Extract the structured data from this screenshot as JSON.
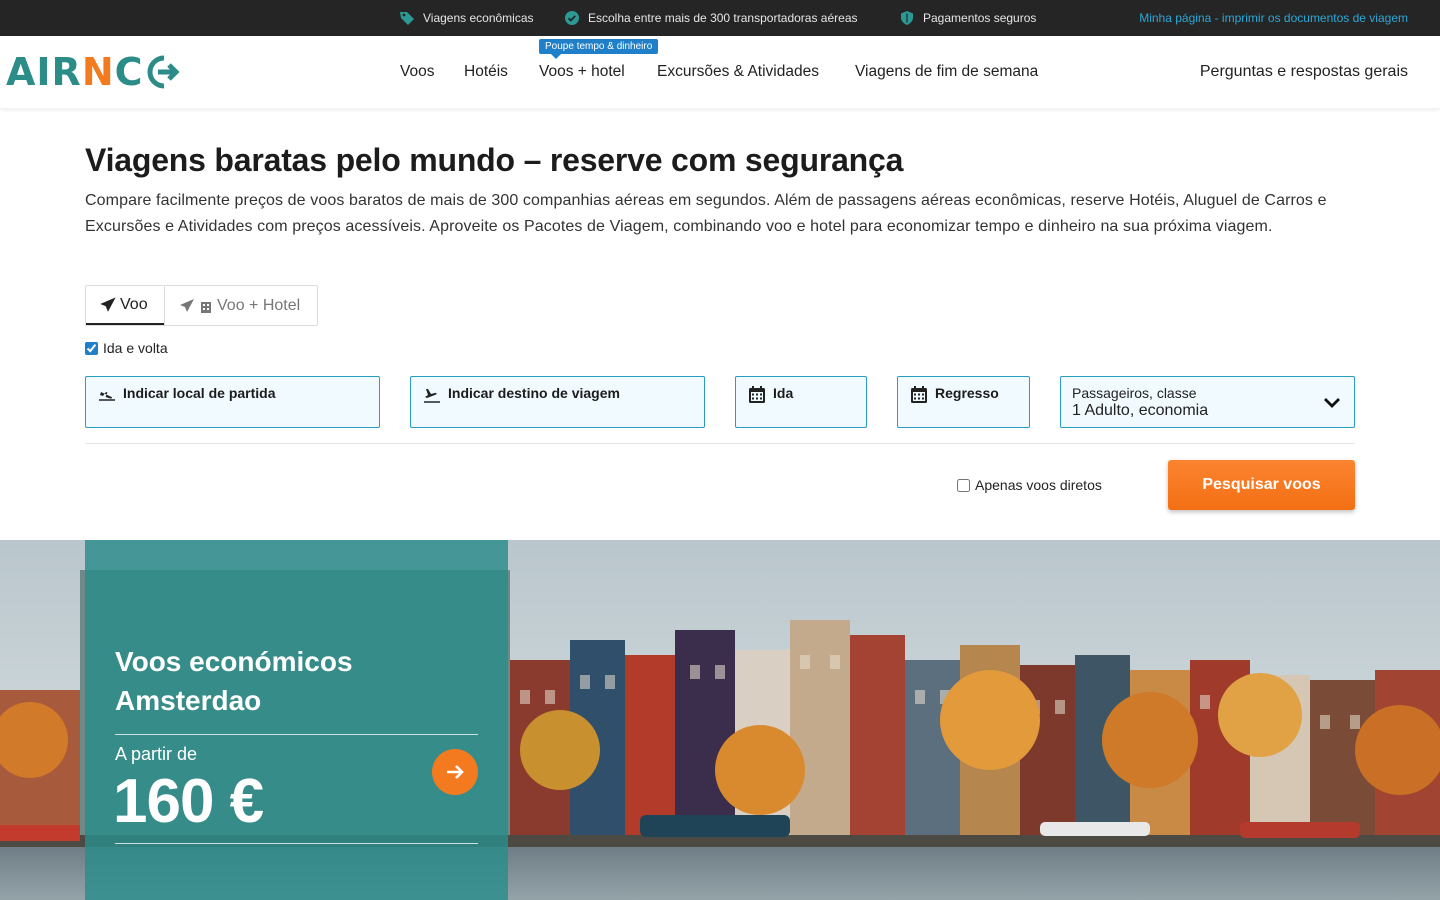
{
  "topbar": {
    "usp1": "Viagens econômicas",
    "usp2": "Escolha entre mais de 300 transportadoras aéreas",
    "usp3": "Pagamentos seguros",
    "my_page": "Minha página - imprimir os documentos de viagem"
  },
  "header": {
    "logo_prefix": "AIR",
    "logo_orange": "N",
    "logo_suffix": "C",
    "nav": {
      "flights": "Voos",
      "hotels": "Hotéis",
      "flight_hotel": "Voos + hotel",
      "flight_hotel_badge": "Poupe tempo & dinheiro",
      "excursions": "Excursões & Atividades",
      "weekend": "Viagens de fim de semana"
    },
    "faq": "Perguntas e respostas gerais"
  },
  "hero": {
    "title": "Viagens baratas pelo mundo – reserve com segurança",
    "intro": "Compare facilmente preços de voos baratos de mais de 300 companhias aéreas em segundos. Além de passagens aéreas econômicas, reserve Hotéis, Aluguel de Carros e Excursões e Atividades com preços acessíveis. Aproveite os Pacotes de Viagem, combinando voo e hotel para economizar tempo e dinheiro na sua próxima viagem."
  },
  "search": {
    "tabs": {
      "flight": "Voo",
      "flight_hotel": "Voo + Hotel"
    },
    "round_trip_label": "Ida e volta",
    "round_trip_checked": true,
    "origin_label": "Indicar local de partida",
    "destination_label": "Indicar destino de viagem",
    "depart_label": "Ida",
    "return_label": "Regresso",
    "passengers_label": "Passageiros, classe",
    "passengers_value": "1 Adulto, economia",
    "direct_only_label": "Apenas voos diretos",
    "direct_only_checked": false,
    "submit_label": "Pesquisar voos"
  },
  "promo": {
    "title_line1": "Voos económicos",
    "title_line2": "Amsterdao",
    "from_label": "A partir de",
    "price": "160 €"
  },
  "colors": {
    "teal": "#2c8c88",
    "orange": "#f47a1f",
    "field_border": "#2a9bc4",
    "field_bg": "#f0faff",
    "link_blue": "#2ca7d6",
    "badge_blue": "#1f7fc8"
  }
}
